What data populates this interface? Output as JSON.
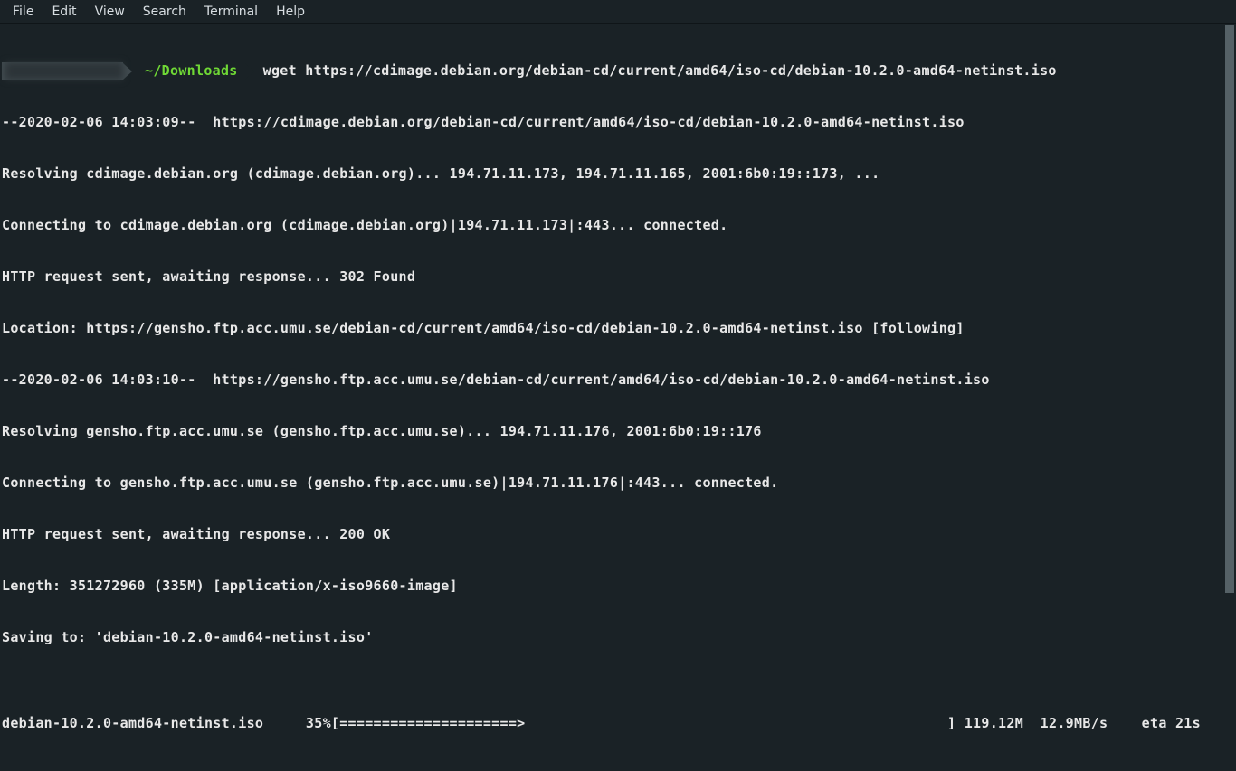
{
  "menubar": {
    "file": "File",
    "edit": "Edit",
    "view": "View",
    "search": "Search",
    "terminal": "Terminal",
    "help": "Help"
  },
  "prompt": {
    "path": "~/Downloads",
    "command": "wget https://cdimage.debian.org/debian-cd/current/amd64/iso-cd/debian-10.2.0-amd64-netinst.iso"
  },
  "output": {
    "line1": "--2020-02-06 14:03:09--  https://cdimage.debian.org/debian-cd/current/amd64/iso-cd/debian-10.2.0-amd64-netinst.iso",
    "line2": "Resolving cdimage.debian.org (cdimage.debian.org)... 194.71.11.173, 194.71.11.165, 2001:6b0:19::173, ...",
    "line3": "Connecting to cdimage.debian.org (cdimage.debian.org)|194.71.11.173|:443... connected.",
    "line4": "HTTP request sent, awaiting response... 302 Found",
    "line5": "Location: https://gensho.ftp.acc.umu.se/debian-cd/current/amd64/iso-cd/debian-10.2.0-amd64-netinst.iso [following]",
    "line6": "--2020-02-06 14:03:10--  https://gensho.ftp.acc.umu.se/debian-cd/current/amd64/iso-cd/debian-10.2.0-amd64-netinst.iso",
    "line7": "Resolving gensho.ftp.acc.umu.se (gensho.ftp.acc.umu.se)... 194.71.11.176, 2001:6b0:19::176",
    "line8": "Connecting to gensho.ftp.acc.umu.se (gensho.ftp.acc.umu.se)|194.71.11.176|:443... connected.",
    "line9": "HTTP request sent, awaiting response... 200 OK",
    "line10": "Length: 351272960 (335M) [application/x-iso9660-image]",
    "line11": "Saving to: 'debian-10.2.0-amd64-netinst.iso'",
    "blank": "",
    "progress": "debian-10.2.0-amd64-netinst.iso     35%[=====================>                                                  ] 119.12M  12.9MB/s    eta 21s    "
  }
}
